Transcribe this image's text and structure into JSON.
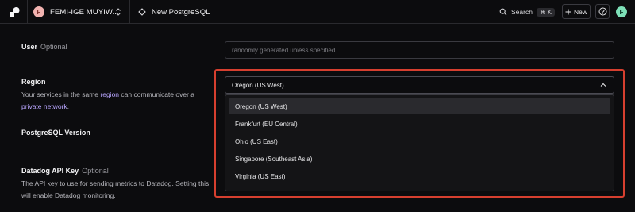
{
  "topbar": {
    "workspace_initial": "F",
    "workspace_name": "FEMI-IGE MUYIW...",
    "page_title": "New PostgreSQL",
    "search_label": "Search",
    "search_shortcut": "⌘ K",
    "new_label": "New",
    "user_initial": "F"
  },
  "form": {
    "user": {
      "label": "User",
      "optional": "Optional",
      "placeholder": "randomly generated unless specified"
    },
    "region": {
      "label": "Region",
      "help_text_1": "Your services in the same",
      "help_link_1": "region",
      "help_text_2": "can communicate over a",
      "help_link_2": "private network",
      "help_text_3": ".",
      "selected": "Oregon (US West)",
      "options": [
        "Oregon (US West)",
        "Frankfurt (EU Central)",
        "Ohio (US East)",
        "Singapore (Southeast Asia)",
        "Virginia (US East)"
      ]
    },
    "postgres_version": {
      "label": "PostgreSQL Version"
    },
    "datadog": {
      "label": "Datadog API Key",
      "optional": "Optional",
      "help": "The API key to use for sending metrics to Datadog. Setting this will enable Datadog monitoring."
    }
  },
  "colors": {
    "highlight": "#d63f2f",
    "link": "#b9a6ff",
    "background": "#0c0c0e"
  }
}
